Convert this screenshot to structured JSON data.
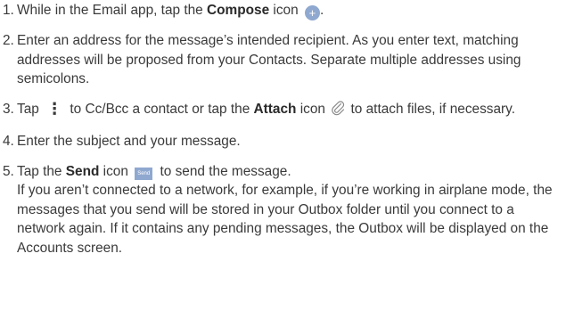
{
  "steps": [
    {
      "num": "1.",
      "pre": "While in the Email app, tap the ",
      "bold": "Compose",
      "post": " icon ",
      "icon_glyph": "+",
      "tail": "."
    },
    {
      "num": "2.",
      "text": "Enter an address for the message’s intended recipient. As you enter text, matching addresses will be proposed from your Contacts. Separate multiple addresses using semicolons."
    },
    {
      "num": "3.",
      "pre": "Tap ",
      "menu_glyph": "⋮",
      "mid": " to Cc/Bcc a contact or tap the ",
      "bold": "Attach",
      "post": " icon ",
      "tail": " to attach files, if necessary."
    },
    {
      "num": "4.",
      "text": "Enter the subject and your message."
    },
    {
      "num": "5.",
      "pre": "Tap the ",
      "bold": "Send",
      "post": " icon ",
      "icon_text": "Send",
      "tail": " to send the message.",
      "note": "If you aren’t connected to a network, for example, if you’re working in airplane mode, the messages that you send will be stored in your Outbox folder until you connect to a network again. If it contains any pending messages, the Outbox will be displayed on the Accounts screen."
    }
  ],
  "colors": {
    "icon_blue": "#8fa8cf",
    "text": "#3a3a3a"
  },
  "icons": [
    "compose-icon",
    "menu-icon",
    "attach-icon",
    "send-icon"
  ]
}
